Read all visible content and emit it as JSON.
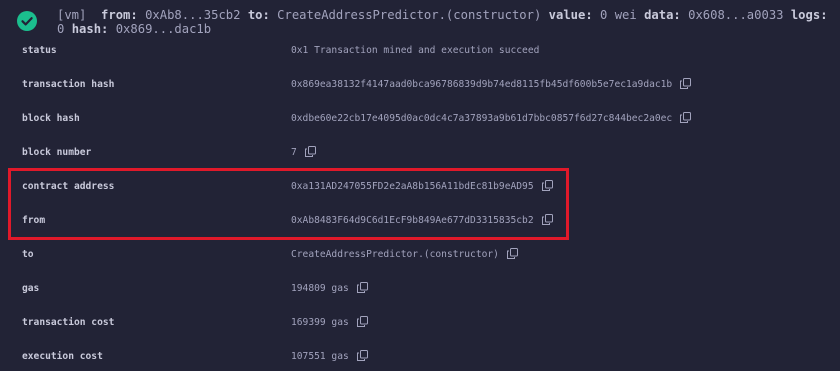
{
  "header": {
    "tag": "[vm]",
    "from_key": "from:",
    "from_value": "0xAb8...35cb2",
    "to_key": "to:",
    "to_value": "CreateAddressPredictor.(constructor)",
    "value_key": "value:",
    "value_value": "0 wei",
    "data_key": "data:",
    "data_value": "0x608...a0033",
    "logs_key": "logs:",
    "logs_value": "0",
    "hash_key": "hash:",
    "hash_value": "0x869...dac1b"
  },
  "details": [
    {
      "label": "status",
      "value": "0x1 Transaction mined and execution succeed",
      "copy": false
    },
    {
      "label": "transaction hash",
      "value": "0x869ea38132f4147aad0bca96786839d9b74ed8115fb45df600b5e7ec1a9dac1b",
      "copy": true
    },
    {
      "label": "block hash",
      "value": "0xdbe60e22cb17e4095d0ac0dc4c7a37893a9b61d7bbc0857f6d27c844bec2a0ec",
      "copy": true
    },
    {
      "label": "block number",
      "value": "7",
      "copy": true
    },
    {
      "label": "contract address",
      "value": "0xa131AD247055FD2e2aA8b156A11bdEc81b9eAD95",
      "copy": true
    },
    {
      "label": "from",
      "value": "0xAb8483F64d9C6d1EcF9b849Ae677dD3315835cb2",
      "copy": true
    },
    {
      "label": "to",
      "value": "CreateAddressPredictor.(constructor)",
      "copy": true
    },
    {
      "label": "gas",
      "value": "194809 gas",
      "copy": true
    },
    {
      "label": "transaction cost",
      "value": "169399 gas",
      "copy": true
    },
    {
      "label": "execution cost",
      "value": "107551 gas",
      "copy": true
    }
  ],
  "colors": {
    "background": "#222336",
    "success": "#1bbe8e",
    "highlight": "#e0192a"
  }
}
